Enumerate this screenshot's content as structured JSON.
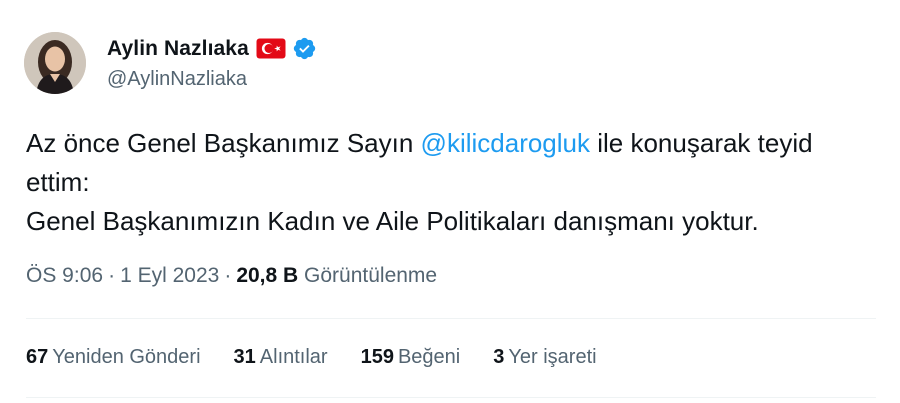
{
  "author": {
    "display_name": "Aylin Nazlıaka",
    "handle": "@AylinNazliaka",
    "flag": "turkey-flag",
    "verified_color": "#1d9bf0"
  },
  "tweet": {
    "line1_before": "Az önce Genel Başkanımız Sayın ",
    "mention": "@kilicdarogluk",
    "line1_after": " ile konuşarak teyid",
    "line2": "ettim:",
    "line3": "Genel Başkanımızın Kadın ve Aile Politikaları danışmanı yoktur."
  },
  "meta": {
    "time": "ÖS 9:06",
    "separator": "·",
    "date": "1 Eyl 2023",
    "views_count": "20,8 B",
    "views_label": "Görüntülenme"
  },
  "stats": [
    {
      "count": "67",
      "label": "Yeniden Gönderi"
    },
    {
      "count": "31",
      "label": "Alıntılar"
    },
    {
      "count": "159",
      "label": "Beğeni"
    },
    {
      "count": "3",
      "label": "Yer işareti"
    }
  ],
  "colors": {
    "link": "#1d9bf0",
    "secondary_text": "#536471",
    "primary_text": "#0f1419"
  }
}
